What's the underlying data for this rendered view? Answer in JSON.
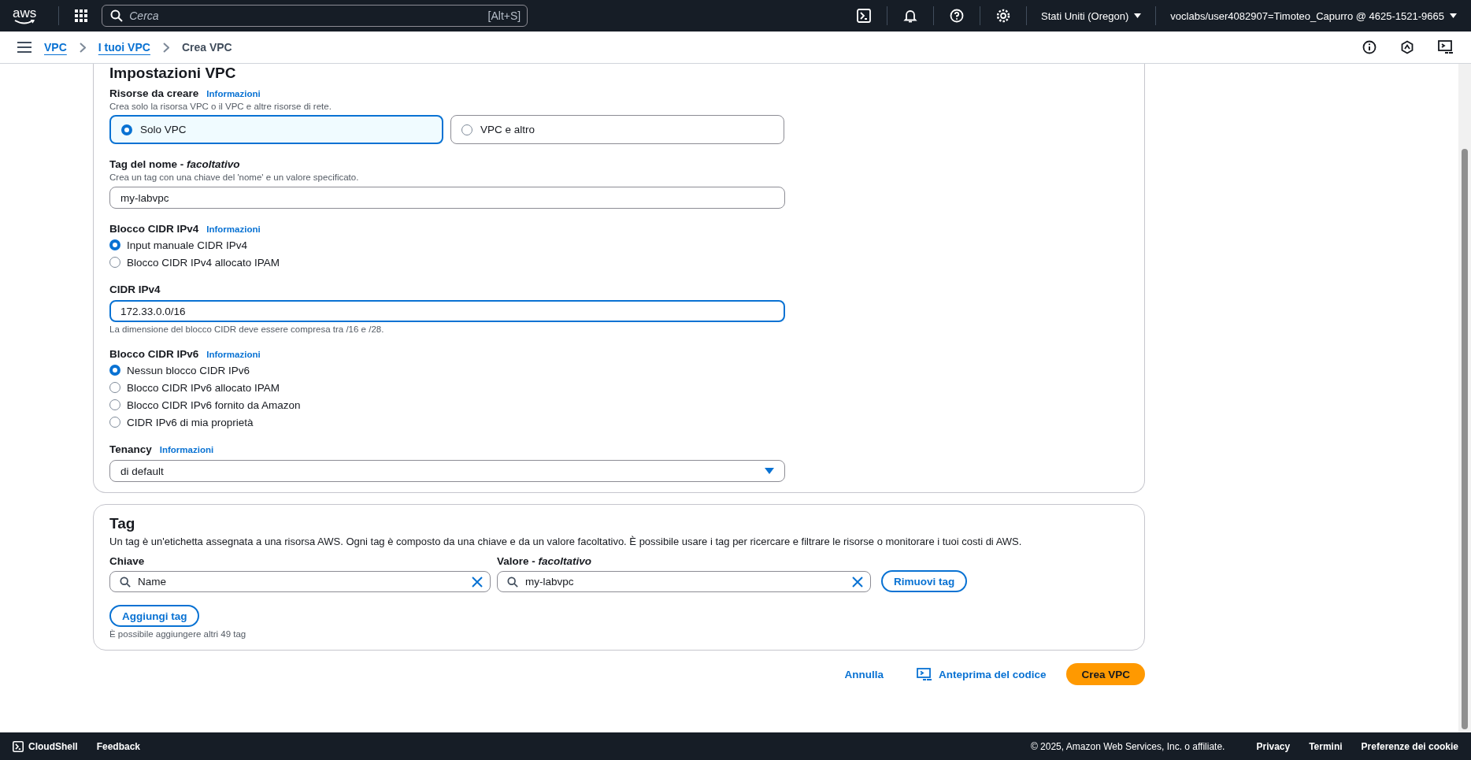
{
  "top_bar": {
    "logo": "aws",
    "search": {
      "placeholder": "Cerca",
      "shortcut": "[Alt+S]"
    },
    "region": "Stati Uniti (Oregon)",
    "account": "voclabs/user4082907=Timoteo_Capurro @ 4625-1521-9665"
  },
  "breadcrumbs": [
    {
      "label": "VPC",
      "link": true
    },
    {
      "label": "I tuoi VPC",
      "link": true
    },
    {
      "label": "Crea VPC",
      "link": false
    }
  ],
  "settings": {
    "title": "Impostazioni VPC",
    "fields": [
      {
        "kind": "tiles",
        "label": "Risorse da creare",
        "info": "Informazioni",
        "description": "Crea solo la risorsa VPC o il VPC e altre risorse di rete.",
        "options": [
          {
            "label": "Solo VPC",
            "selected": true
          },
          {
            "label": "VPC e altro",
            "selected": false
          }
        ]
      },
      {
        "kind": "text",
        "label": "Tag del nome - *facoltativo*",
        "description": "Crea un tag con una chiave del 'nome' e un valore specificato.",
        "value": "my-labvpc",
        "focused": false
      },
      {
        "kind": "radio",
        "label": "Blocco CIDR IPv4",
        "info": "Informazioni",
        "options": [
          {
            "label": "Input manuale CIDR IPv4",
            "selected": true
          },
          {
            "label": "Blocco CIDR IPv4 allocato IPAM",
            "selected": false
          }
        ]
      },
      {
        "kind": "text",
        "label": "CIDR IPv4",
        "value": "172.33.0.0/16",
        "focused": true,
        "hint": "La dimensione del blocco CIDR deve essere compresa tra /16 e /28."
      },
      {
        "kind": "radio",
        "label": "Blocco CIDR IPv6",
        "info": "Informazioni",
        "options": [
          {
            "label": "Nessun blocco CIDR IPv6",
            "selected": true
          },
          {
            "label": "Blocco CIDR IPv6 allocato IPAM",
            "selected": false
          },
          {
            "label": "Blocco CIDR IPv6 fornito da Amazon",
            "selected": false
          },
          {
            "label": "CIDR IPv6 di mia proprietà",
            "selected": false
          }
        ]
      },
      {
        "kind": "select",
        "label": "Tenancy",
        "info": "Informazioni",
        "value": "di default"
      }
    ]
  },
  "tags": {
    "title": "Tag",
    "description": "Un tag è un'etichetta assegnata a una risorsa AWS. Ogni tag è composto da una chiave e da un valore facoltativo. È possibile usare i tag per ricercare e filtrare le risorse o monitorare i tuoi costi di AWS.",
    "key_label": "Chiave",
    "value_label": "Valore - *facoltativo*",
    "rows": [
      {
        "key": "Name",
        "value": "my-labvpc",
        "remove": "Rimuovi tag"
      }
    ],
    "add": "Aggiungi tag",
    "hint": "È possibile aggiungere altri 49 tag"
  },
  "actions": {
    "cancel": "Annulla",
    "preview": "Anteprima del codice",
    "create": "Crea VPC"
  },
  "footer": {
    "cloudshell": "CloudShell",
    "feedback": "Feedback",
    "copyright": "© 2025, Amazon Web Services, Inc. o affiliate.",
    "links": [
      "Privacy",
      "Termini",
      "Preferenze dei cookie"
    ]
  }
}
